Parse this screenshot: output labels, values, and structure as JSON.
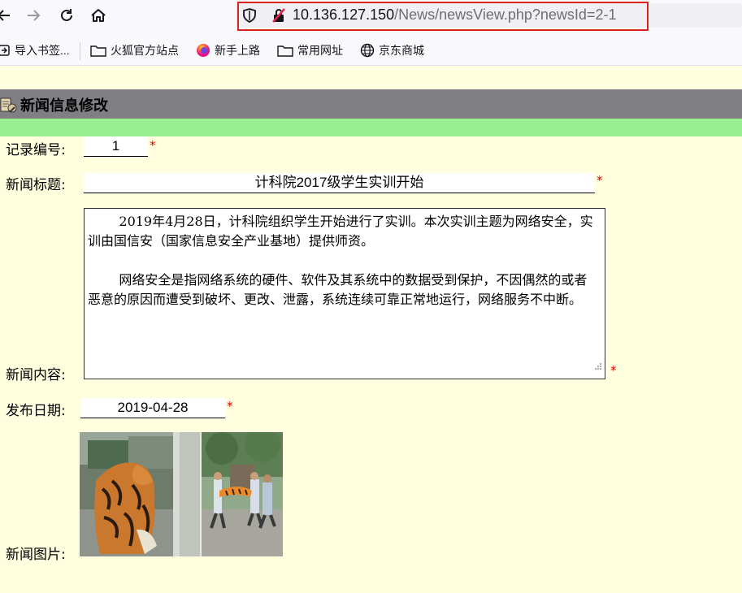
{
  "browser": {
    "url_host": "10.136.127.150",
    "url_path": "/News/newsView.php?newsId=2-1",
    "bookmarks": [
      {
        "label": "导入书签..."
      },
      {
        "label": "火狐官方站点"
      },
      {
        "label": "新手上路"
      },
      {
        "label": "常用网址"
      },
      {
        "label": "京东商城"
      }
    ]
  },
  "page": {
    "title": "新闻信息修改",
    "fields": {
      "record_id": {
        "label": "记录编号:",
        "value": "1",
        "required": "*"
      },
      "news_title": {
        "label": "新闻标题:",
        "value": "计科院2017级学生实训开始",
        "required": "*"
      },
      "news_content": {
        "label": "新闻内容:",
        "paragraph1": "2019年4月28日，计科院组织学生开始进行了实训。本次实训主题为网络安全，实训由国信安（国家信息安全产业基地）提供师资。",
        "paragraph2": "网络安全是指网络系统的硬件、软件及其系统中的数据受到保护，不因偶然的或者恶意的原因而遭受到破坏、更改、泄露，系统连续可靠正常地运行，网络服务不中断。",
        "required": "*"
      },
      "publish_date": {
        "label": "发布日期:",
        "value": "2019-04-28",
        "required": "*"
      },
      "news_image": {
        "label": "新闻图片:"
      }
    }
  },
  "colors": {
    "page_bg": "#FFFFE0",
    "title_bar": "#807F84",
    "green_bar": "#98EE90",
    "highlight_box": "#D9261C",
    "required": "#E00000"
  },
  "icons": [
    "back-arrow-icon",
    "forward-arrow-icon",
    "reload-icon",
    "home-icon",
    "shield-icon",
    "insecure-lock-icon",
    "import-icon",
    "folder-icon",
    "firefox-icon",
    "globe-icon",
    "news-edit-icon",
    "resize-grip-icon"
  ]
}
